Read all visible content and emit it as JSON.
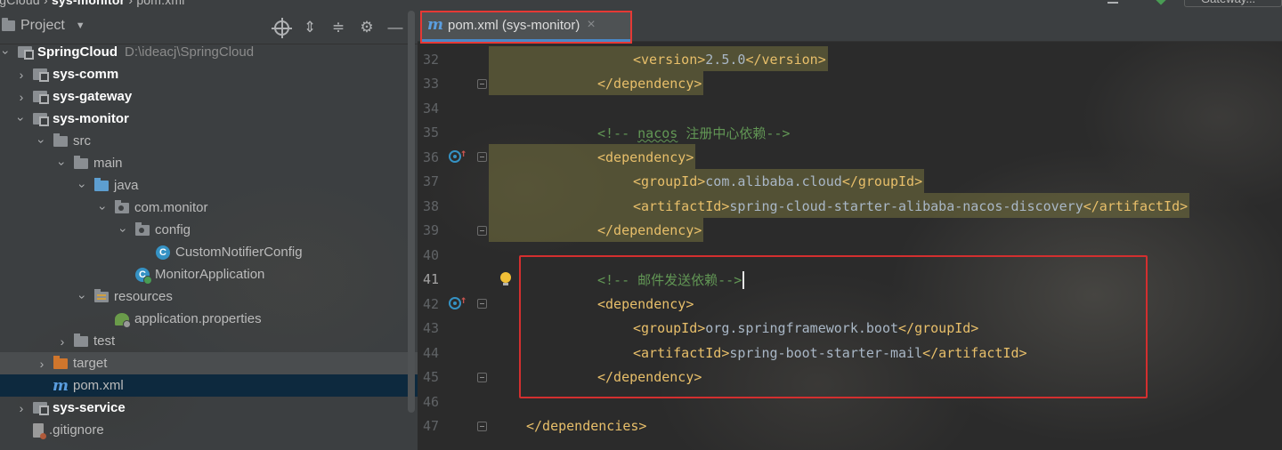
{
  "top_strip": {
    "breadcrumb_left": "igCloud",
    "breadcrumb_mid": "sys-monitor",
    "breadcrumb_file": "pom.xml",
    "run_config": "Gateway..."
  },
  "project_panel": {
    "title": "Project",
    "tree": [
      {
        "label": "SpringCloud",
        "path": "D:\\ideacj\\SpringCloud",
        "icon": "module-icon",
        "indent": 0,
        "arrow": "down",
        "bold": true
      },
      {
        "label": "sys-comm",
        "icon": "module-icon",
        "indent": 1,
        "arrow": "right",
        "bold": true
      },
      {
        "label": "sys-gateway",
        "icon": "module-icon",
        "indent": 1,
        "arrow": "right",
        "bold": true
      },
      {
        "label": "sys-monitor",
        "icon": "module-icon",
        "indent": 1,
        "arrow": "down",
        "bold": true
      },
      {
        "label": "src",
        "icon": "folder-icon",
        "indent": 2,
        "arrow": "down"
      },
      {
        "label": "main",
        "icon": "folder-icon",
        "indent": 3,
        "arrow": "down"
      },
      {
        "label": "java",
        "icon": "source-folder-icon",
        "indent": 4,
        "arrow": "down"
      },
      {
        "label": "com.monitor",
        "icon": "package-icon",
        "indent": 5,
        "arrow": "down"
      },
      {
        "label": "config",
        "icon": "package-icon",
        "indent": 6,
        "arrow": "down"
      },
      {
        "label": "CustomNotifierConfig",
        "icon": "class-icon",
        "indent": 7,
        "arrow": "none"
      },
      {
        "label": "MonitorApplication",
        "icon": "spring-boot-class-icon",
        "indent": 6,
        "arrow": "none"
      },
      {
        "label": "resources",
        "icon": "resources-folder-icon",
        "indent": 4,
        "arrow": "down"
      },
      {
        "label": "application.properties",
        "icon": "properties-icon",
        "indent": 5,
        "arrow": "none"
      },
      {
        "label": "test",
        "icon": "folder-icon",
        "indent": 3,
        "arrow": "right"
      },
      {
        "label": "target",
        "icon": "target-folder-icon",
        "indent": 2,
        "arrow": "right",
        "state": "excluded"
      },
      {
        "label": "pom.xml",
        "icon": "maven-icon",
        "indent": 2,
        "arrow": "none",
        "state": "selected"
      },
      {
        "label": "sys-service",
        "icon": "module-icon",
        "indent": 1,
        "arrow": "right",
        "bold": true
      },
      {
        "label": ".gitignore",
        "icon": "gitignore-icon",
        "indent": 1,
        "arrow": "none"
      }
    ]
  },
  "editor": {
    "tab_label": "pom.xml (sys-monitor)",
    "current_line": "41",
    "lines": [
      {
        "n": "32",
        "indent": 2,
        "parts": [
          [
            "tag",
            "<version>"
          ],
          [
            "txt",
            "2.5.0"
          ],
          [
            "tag",
            "</version>"
          ]
        ],
        "hl": true
      },
      {
        "n": "33",
        "indent": 1,
        "parts": [
          [
            "tag",
            "</dependency>"
          ]
        ],
        "hl": true,
        "fold": true
      },
      {
        "n": "34",
        "indent": 0,
        "parts": []
      },
      {
        "n": "35",
        "indent": 1,
        "parts": [
          [
            "cmt",
            "<!-- "
          ],
          [
            "cmtu",
            "nacos"
          ],
          [
            "cmt",
            " 注册中心依赖-->"
          ]
        ]
      },
      {
        "n": "36",
        "indent": 1,
        "parts": [
          [
            "tag",
            "<dependency>"
          ]
        ],
        "hl": true,
        "fold": true,
        "marker": true
      },
      {
        "n": "37",
        "indent": 2,
        "parts": [
          [
            "tag",
            "<groupId>"
          ],
          [
            "txt",
            "com.alibaba.cloud"
          ],
          [
            "tag",
            "</groupId>"
          ]
        ],
        "hl": true
      },
      {
        "n": "38",
        "indent": 2,
        "parts": [
          [
            "tag",
            "<artifactId>"
          ],
          [
            "txt",
            "spring-cloud-starter-alibaba-nacos-discovery"
          ],
          [
            "tag",
            "</artifactId>"
          ]
        ],
        "hl": true
      },
      {
        "n": "39",
        "indent": 1,
        "parts": [
          [
            "tag",
            "</dependency>"
          ]
        ],
        "hl": true,
        "fold": true
      },
      {
        "n": "40",
        "indent": 0,
        "parts": []
      },
      {
        "n": "41",
        "indent": 1,
        "parts": [
          [
            "cmt",
            "<!-- 邮件发送依赖-->"
          ]
        ],
        "bulb": true,
        "caret": true
      },
      {
        "n": "42",
        "indent": 1,
        "parts": [
          [
            "tag",
            "<dependency>"
          ]
        ],
        "fold": true,
        "marker": true
      },
      {
        "n": "43",
        "indent": 2,
        "parts": [
          [
            "tag",
            "<groupId>"
          ],
          [
            "txt",
            "org.springframework.boot"
          ],
          [
            "tag",
            "</groupId>"
          ]
        ]
      },
      {
        "n": "44",
        "indent": 2,
        "parts": [
          [
            "tag",
            "<artifactId>"
          ],
          [
            "txt",
            "spring-boot-starter-mail"
          ],
          [
            "tag",
            "</artifactId>"
          ]
        ]
      },
      {
        "n": "45",
        "indent": 1,
        "parts": [
          [
            "tag",
            "</dependency>"
          ]
        ],
        "fold": true
      },
      {
        "n": "46",
        "indent": 0,
        "parts": []
      },
      {
        "n": "47",
        "indent": -1,
        "parts": [
          [
            "tag",
            "</dependencies>"
          ]
        ],
        "fold": true
      }
    ]
  },
  "colors": {
    "tag": "#e8bf6a",
    "text": "#a9b7c6",
    "comment": "#629755",
    "highlight_block": "#74713e",
    "annotation_red": "#d32f2f",
    "selection": "#0d293e"
  }
}
